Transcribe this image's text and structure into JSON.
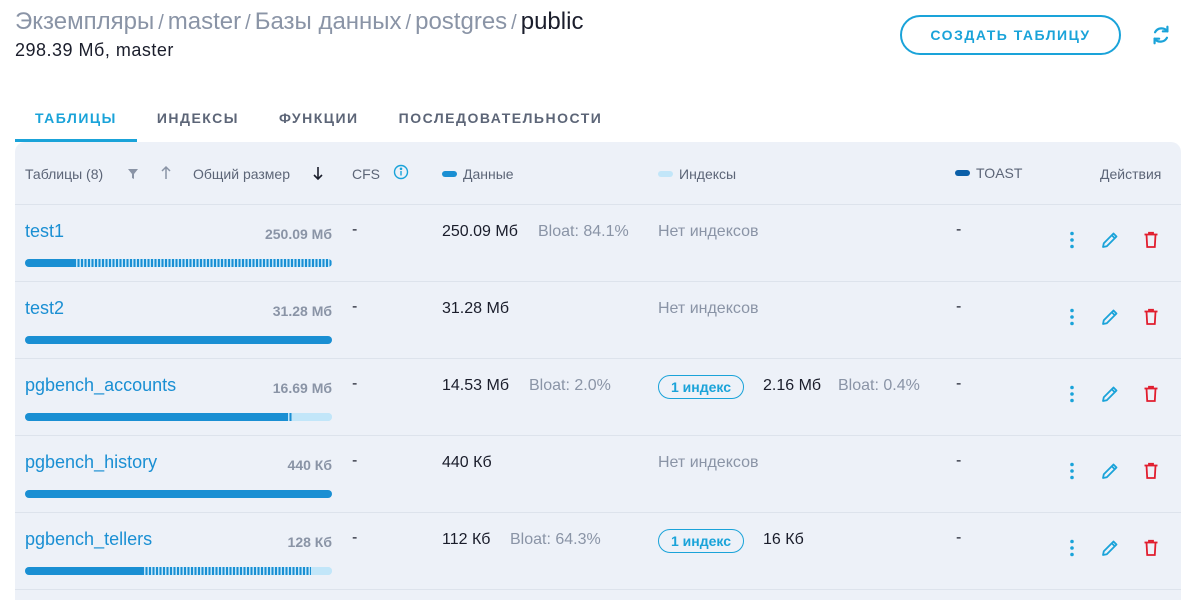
{
  "breadcrumb": {
    "items": [
      "Экземпляры",
      "master",
      "Базы данных",
      "postgres"
    ],
    "separator": "/",
    "current": "public"
  },
  "subtitle": "298.39 Мб, master",
  "header": {
    "create_label": "СОЗДАТЬ ТАБЛИЦУ",
    "refresh_icon": "refresh-icon"
  },
  "tabs": [
    {
      "label": "ТАБЛИЦЫ",
      "active": true
    },
    {
      "label": "ИНДЕКСЫ",
      "active": false
    },
    {
      "label": "ФУНКЦИИ",
      "active": false
    },
    {
      "label": "ПОСЛЕДОВАТЕЛЬНОСТИ",
      "active": false
    }
  ],
  "columns": {
    "tables": "Таблицы (8)",
    "total_size": "Общий размер",
    "cfs": "CFS",
    "data": "Данные",
    "indexes": "Индексы",
    "toast": "TOAST",
    "actions": "Действия"
  },
  "colors": {
    "accent": "#1aa3d9",
    "data": "#1a8fd3",
    "index": "#c2e6f9",
    "toast": "#0b5fa8",
    "delete": "#e11d2e"
  },
  "rows": [
    {
      "name": "test1",
      "total": "250.09 Мб",
      "cfs": "-",
      "data_size": "250.09 Мб",
      "bloat": "Bloat: 84.1%",
      "no_index": "Нет индексов",
      "index_badge": "",
      "index_size": "",
      "index_bloat": "",
      "toast": "-",
      "bar": {
        "data": 0.16,
        "bloat": 0.84,
        "index": 0.0
      }
    },
    {
      "name": "test2",
      "total": "31.28 Мб",
      "cfs": "-",
      "data_size": "31.28 Мб",
      "bloat": "",
      "no_index": "Нет индексов",
      "index_badge": "",
      "index_size": "",
      "index_bloat": "",
      "toast": "-",
      "bar": {
        "data": 1.0,
        "bloat": 0.0,
        "index": 0.0
      }
    },
    {
      "name": "pgbench_accounts",
      "total": "16.69 Мб",
      "cfs": "-",
      "data_size": "14.53 Мб",
      "bloat": "Bloat: 2.0%",
      "no_index": "",
      "index_badge": "1 индекс",
      "index_size": "2.16 Мб",
      "index_bloat": "Bloat: 0.4%",
      "toast": "-",
      "bar": {
        "data": 0.85,
        "bloat": 0.02,
        "index": 0.13
      }
    },
    {
      "name": "pgbench_history",
      "total": "440 Кб",
      "cfs": "-",
      "data_size": "440 Кб",
      "bloat": "",
      "no_index": "Нет индексов",
      "index_badge": "",
      "index_size": "",
      "index_bloat": "",
      "toast": "-",
      "bar": {
        "data": 1.0,
        "bloat": 0.0,
        "index": 0.0
      }
    },
    {
      "name": "pgbench_tellers",
      "total": "128 Кб",
      "cfs": "-",
      "data_size": "112 Кб",
      "bloat": "Bloat: 64.3%",
      "no_index": "",
      "index_badge": "1 индекс",
      "index_size": "16 Кб",
      "index_bloat": "",
      "toast": "-",
      "bar": {
        "data": 0.38,
        "bloat": 0.55,
        "index": 0.07
      }
    }
  ]
}
